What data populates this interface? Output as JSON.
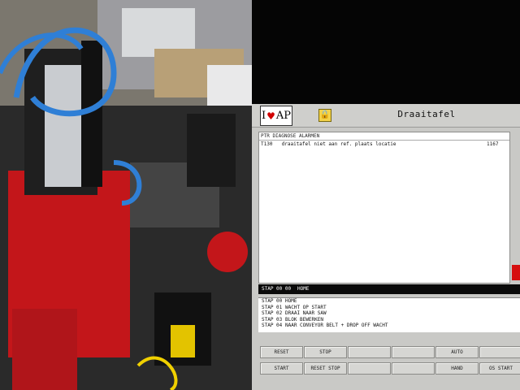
{
  "app": {
    "title": "Draaitafel",
    "logo_text_i": "I",
    "logo_text_ap": "AP",
    "logo_heart": "♥",
    "lock_glyph": "🔒"
  },
  "alarms": {
    "header": "PTR   DIAGNOSE ALARMEN",
    "rows": [
      {
        "code": "T130",
        "text": "draaitafel niet aan ref. plaats locatie",
        "num": "1167"
      }
    ]
  },
  "stap": {
    "value": "STAP 00 00",
    "name": "HOME"
  },
  "steps": [
    {
      "key": "STAP 00",
      "label": "HOME"
    },
    {
      "key": "STAP 01",
      "label": "WACHT OP START"
    },
    {
      "key": "STAP 02",
      "label": "DRAAI NAAR SAW"
    },
    {
      "key": "STAP 03",
      "label": "BLOK BEWERKEN"
    },
    {
      "key": "STAP 04",
      "label": "NAAR CONVEYOR BELT + DROP OFF WACHT"
    }
  ],
  "buttons": {
    "reset": "RESET",
    "stop": "STOP",
    "auto": "AUTO",
    "start": "START",
    "reset_stop": "RESET STOP",
    "hand": "HAND",
    "os_start": "OS START"
  },
  "colors": {
    "alarm_red": "#d60f0f",
    "accent_blue": "#2f7fd6"
  }
}
